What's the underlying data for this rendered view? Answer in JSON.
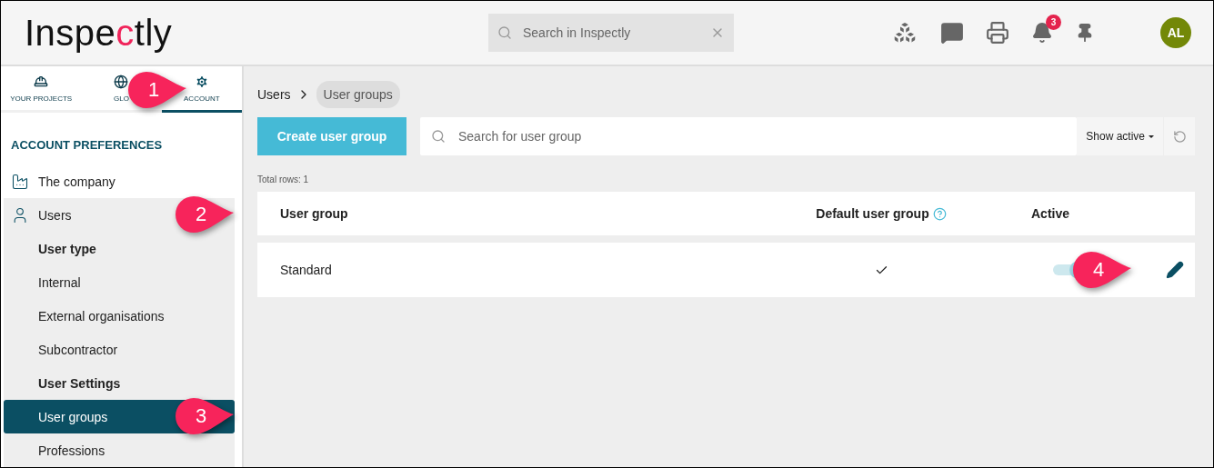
{
  "header": {
    "logo": {
      "before": "Inspe",
      "accent": "c",
      "after": "tly"
    },
    "search": {
      "placeholder": "Search in Inspectly"
    },
    "notifications": "3",
    "avatar": "AL"
  },
  "tabs": [
    {
      "kind": "helmet",
      "label": "YOUR PROJECTS",
      "selected": false
    },
    {
      "kind": "globe",
      "label": "GLO",
      "selected": false
    },
    {
      "kind": "gear",
      "label": "ACCOUNT",
      "selected": true,
      "callout": "1"
    }
  ],
  "sidebar": {
    "heading": "ACCOUNT PREFERENCES",
    "items": [
      {
        "kind": "top",
        "label": "The company",
        "selected": false
      },
      {
        "kind": "top",
        "label": "Users",
        "selected": false,
        "expanded": true,
        "callout": "2"
      },
      {
        "kind": "section",
        "label": "User type"
      },
      {
        "kind": "sub",
        "label": "Internal",
        "selected": false
      },
      {
        "kind": "sub",
        "label": "External organisations",
        "selected": false
      },
      {
        "kind": "sub",
        "label": "Subcontractor",
        "selected": false
      },
      {
        "kind": "section",
        "label": "User Settings"
      },
      {
        "kind": "sub",
        "label": "User groups",
        "selected": true,
        "callout": "3"
      },
      {
        "kind": "sub",
        "label": "Professions",
        "selected": false
      }
    ]
  },
  "breadcrumb": [
    "Users",
    "User groups"
  ],
  "toolbar": {
    "create": "Create user group",
    "search": {
      "placeholder": "Search for user group"
    },
    "filter": "Show active"
  },
  "total_rows": "Total rows: 1",
  "table": {
    "columns": [
      "User group",
      "Default user group",
      "Active"
    ],
    "rows": [
      {
        "name": "Standard",
        "default": true,
        "active": true,
        "callout": "4"
      }
    ]
  }
}
